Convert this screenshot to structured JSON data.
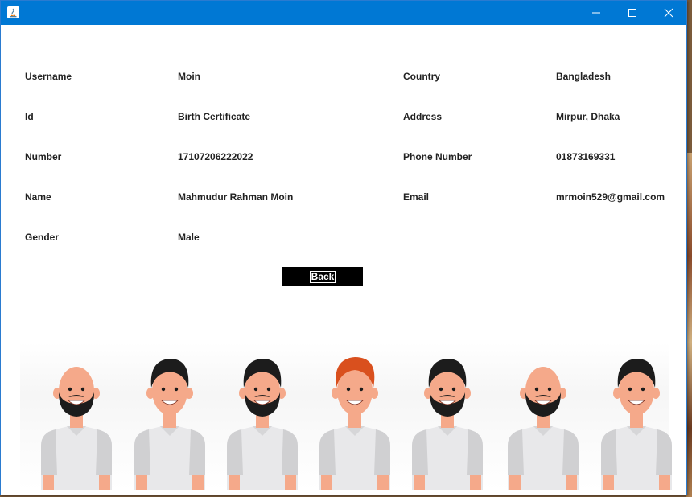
{
  "window": {
    "controls": {
      "minimize_icon": "minimize-icon",
      "maximize_icon": "maximize-icon",
      "close_icon": "close-icon"
    }
  },
  "profile": {
    "left": [
      {
        "label": "Username",
        "value": "Moin"
      },
      {
        "label": "Id",
        "value": "Birth Certificate"
      },
      {
        "label": "Number",
        "value": "17107206222022"
      },
      {
        "label": "Name",
        "value": "Mahmudur Rahman Moin"
      },
      {
        "label": "Gender",
        "value": "Male"
      }
    ],
    "right": [
      {
        "label": "Country",
        "value": "Bangladesh"
      },
      {
        "label": "Address",
        "value": "Mirpur, Dhaka"
      },
      {
        "label": "Phone Number",
        "value": "01873169331"
      },
      {
        "label": "Email",
        "value": "mrmoin529@gmail.com"
      }
    ]
  },
  "back_label": "Back",
  "colors": {
    "titlebar": "#0078d4",
    "button_bg": "#000000",
    "skin": "#f5a98a",
    "shirt": "#e8e8ea",
    "sleeve": "#d0d0d2",
    "beard": "#1c1c1c",
    "red_hair": "#d9501e"
  },
  "illustration": {
    "people": [
      {
        "hair": "bald",
        "beard": "full"
      },
      {
        "hair": "black",
        "beard": "none"
      },
      {
        "hair": "black",
        "beard": "full"
      },
      {
        "hair": "red",
        "beard": "none"
      },
      {
        "hair": "black",
        "beard": "full"
      },
      {
        "hair": "bald",
        "beard": "full"
      },
      {
        "hair": "black",
        "beard": "none"
      }
    ]
  }
}
